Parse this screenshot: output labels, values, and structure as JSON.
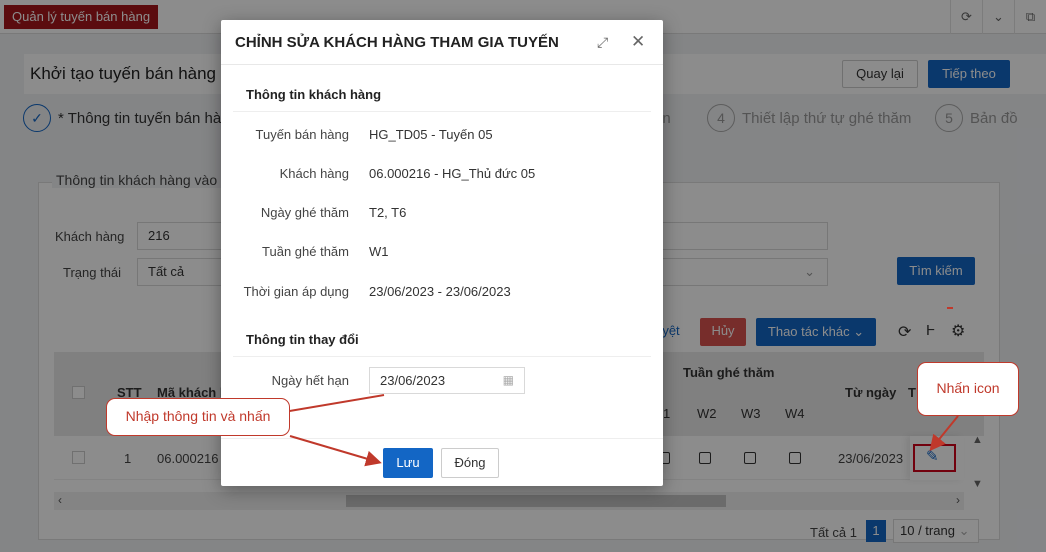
{
  "app_tab": "Quản lý tuyến bán hàng",
  "page": {
    "title": "Khởi tạo tuyến bán hàng",
    "back_label": "Quay lại",
    "next_label": "Tiếp theo"
  },
  "steps": {
    "step1": "* Thông tin tuyến bán hàng",
    "step3_tail": "ên",
    "step4_num": "4",
    "step4": "Thiết lập thứ tự ghé thăm",
    "step5_num": "5",
    "step5": "Bản đồ"
  },
  "section": {
    "legend": "Thông tin khách hàng vào",
    "customer_label": "Khách hàng",
    "customer_value": "216",
    "status_label": "Trạng thái",
    "status_value": "Tất cả",
    "search_tail": "g",
    "search_button": "Tìm kiếm",
    "action_tail": "yệt",
    "cancel_button": "Hủy",
    "other_actions": "Thao tác khác"
  },
  "table": {
    "col_stt": "STT",
    "col_code": "Mã khách h",
    "col_week_visit": "Tuần ghé thăm",
    "col_w1_tail": "1",
    "col_w2": "W2",
    "col_w3": "W3",
    "col_w4": "W4",
    "col_from": "Từ ngày",
    "col_t": "T",
    "row_stt": "1",
    "row_code": "06.000216",
    "row_from": "23/06/2023"
  },
  "pagination": {
    "total": "Tất cả 1",
    "page": "1",
    "per_page": "10 / trang"
  },
  "modal": {
    "title": "CHỈNH SỬA KHÁCH HÀNG THAM GIA TUYẾN",
    "section1": "Thông tin khách hàng",
    "route_label": "Tuyến bán hàng",
    "route_value": "HG_TD05 - Tuyến 05",
    "customer_label": "Khách hàng",
    "customer_value": "06.000216 - HG_Thủ đức 05",
    "visit_day_label": "Ngày ghé thăm",
    "visit_day_value": "T2, T6",
    "visit_week_label": "Tuần ghé thăm",
    "visit_week_value": "W1",
    "apply_time_label": "Thời gian áp dụng",
    "apply_time_value": "23/06/2023 - 23/06/2023",
    "section2": "Thông tin thay đổi",
    "expiry_label": "Ngày hết hạn",
    "expiry_value": "23/06/2023",
    "save_button": "Lưu",
    "close_button": "Đóng"
  },
  "callouts": {
    "input_and_click": "Nhập thông tin và nhấn",
    "click_icon": "Nhấn icon"
  },
  "colors": {
    "primary": "#1366c5",
    "app_tab": "#a6171c",
    "callout": "#c0392b"
  }
}
